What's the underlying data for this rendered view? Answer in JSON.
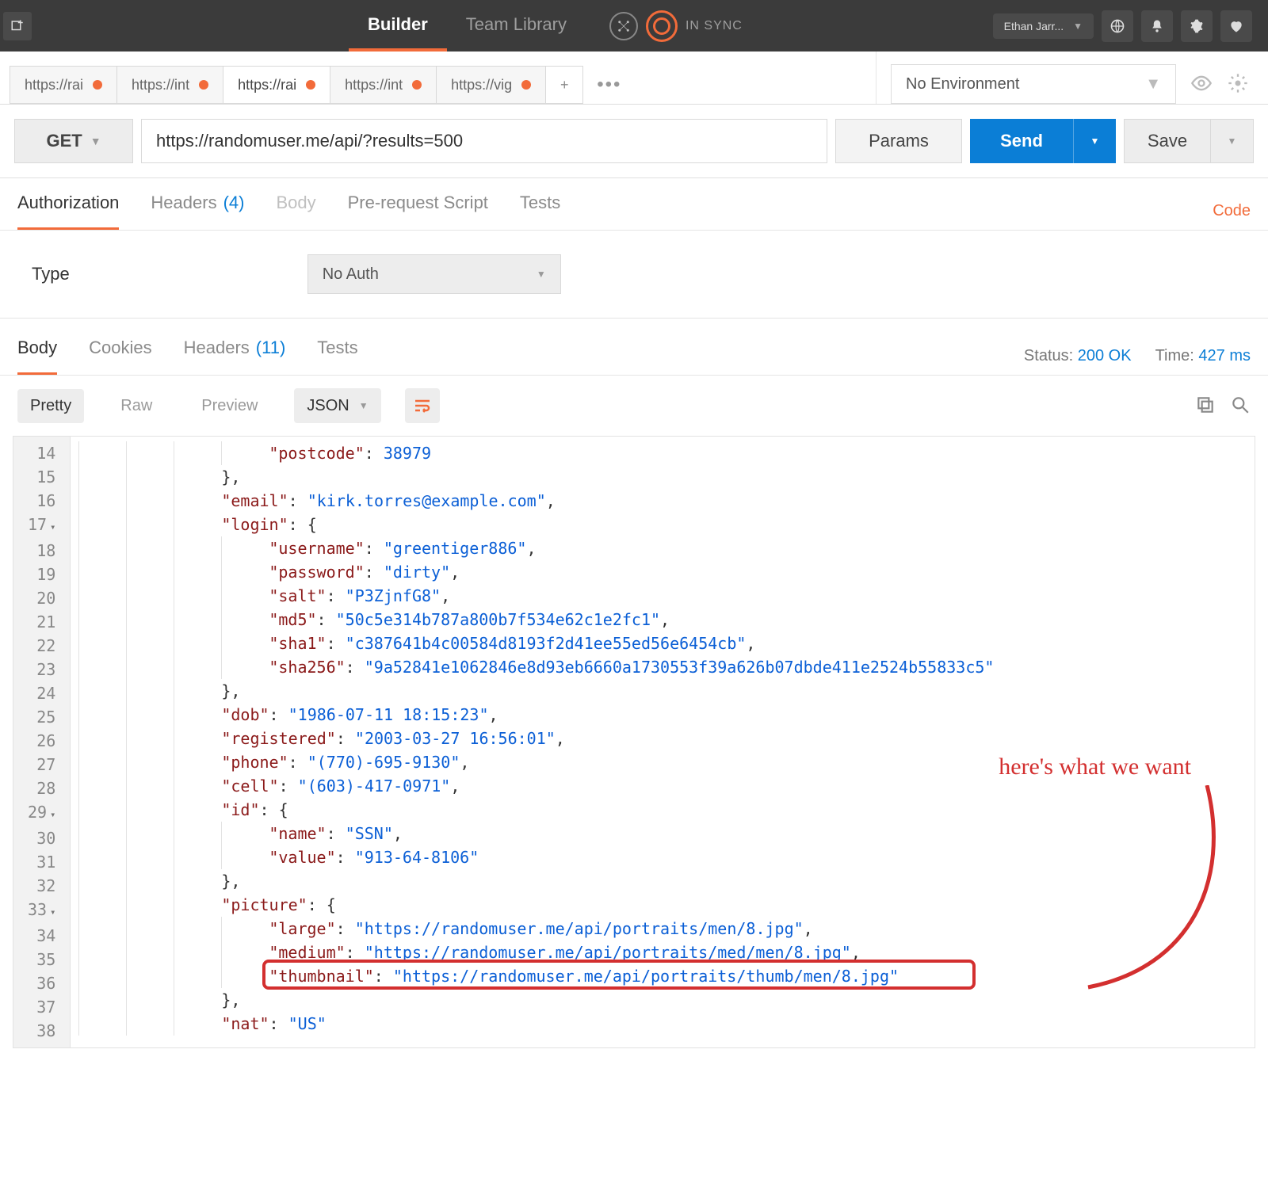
{
  "topbar": {
    "nav": {
      "builder": "Builder",
      "team": "Team Library"
    },
    "sync": "IN SYNC",
    "user": "Ethan Jarr..."
  },
  "tabs": [
    {
      "label": "https://rai",
      "active": false
    },
    {
      "label": "https://int",
      "active": false
    },
    {
      "label": "https://rai",
      "active": true
    },
    {
      "label": "https://int",
      "active": false
    },
    {
      "label": "https://vig",
      "active": false
    }
  ],
  "env": {
    "selected": "No Environment"
  },
  "request": {
    "method": "GET",
    "url": "https://randomuser.me/api/?results=500",
    "params": "Params",
    "send": "Send",
    "save": "Save"
  },
  "reqtabs": {
    "auth": "Authorization",
    "headers": "Headers",
    "headers_count": "(4)",
    "body": "Body",
    "prereq": "Pre-request Script",
    "tests": "Tests",
    "code": "Code"
  },
  "auth": {
    "label": "Type",
    "value": "No Auth"
  },
  "resptabs": {
    "body": "Body",
    "cookies": "Cookies",
    "headers": "Headers",
    "headers_count": "(11)",
    "tests": "Tests",
    "status_label": "Status:",
    "status_value": "200 OK",
    "time_label": "Time:",
    "time_value": "427 ms"
  },
  "viewbar": {
    "pretty": "Pretty",
    "raw": "Raw",
    "preview": "Preview",
    "format": "JSON"
  },
  "code_lines": [
    {
      "n": "14",
      "indent": 3,
      "key": "\"postcode\"",
      "sep": ": ",
      "val": "38979",
      "valclass": "num",
      "tail": ""
    },
    {
      "n": "15",
      "indent": 2,
      "raw": "},",
      "punctonly": true
    },
    {
      "n": "16",
      "indent": 2,
      "key": "\"email\"",
      "sep": ": ",
      "val": "\"kirk.torres@example.com\"",
      "valclass": "str",
      "tail": ","
    },
    {
      "n": "17",
      "fold": true,
      "indent": 2,
      "key": "\"login\"",
      "sep": ": ",
      "raw_after": "{",
      "tail": ""
    },
    {
      "n": "18",
      "indent": 3,
      "key": "\"username\"",
      "sep": ": ",
      "val": "\"greentiger886\"",
      "valclass": "str",
      "tail": ","
    },
    {
      "n": "19",
      "indent": 3,
      "key": "\"password\"",
      "sep": ": ",
      "val": "\"dirty\"",
      "valclass": "str",
      "tail": ","
    },
    {
      "n": "20",
      "indent": 3,
      "key": "\"salt\"",
      "sep": ": ",
      "val": "\"P3ZjnfG8\"",
      "valclass": "str",
      "tail": ","
    },
    {
      "n": "21",
      "indent": 3,
      "key": "\"md5\"",
      "sep": ": ",
      "val": "\"50c5e314b787a800b7f534e62c1e2fc1\"",
      "valclass": "str",
      "tail": ","
    },
    {
      "n": "22",
      "indent": 3,
      "key": "\"sha1\"",
      "sep": ": ",
      "val": "\"c387641b4c00584d8193f2d41ee55ed56e6454cb\"",
      "valclass": "str",
      "tail": ","
    },
    {
      "n": "23",
      "indent": 3,
      "key": "\"sha256\"",
      "sep": ": ",
      "val": "\"9a52841e1062846e8d93eb6660a1730553f39a626b07dbde411e2524b55833c5\"",
      "valclass": "str",
      "tail": ""
    },
    {
      "n": "24",
      "indent": 2,
      "raw": "},",
      "punctonly": true
    },
    {
      "n": "25",
      "indent": 2,
      "key": "\"dob\"",
      "sep": ": ",
      "val": "\"1986-07-11 18:15:23\"",
      "valclass": "str",
      "tail": ","
    },
    {
      "n": "26",
      "indent": 2,
      "key": "\"registered\"",
      "sep": ": ",
      "val": "\"2003-03-27 16:56:01\"",
      "valclass": "str",
      "tail": ","
    },
    {
      "n": "27",
      "indent": 2,
      "key": "\"phone\"",
      "sep": ": ",
      "val": "\"(770)-695-9130\"",
      "valclass": "str",
      "tail": ","
    },
    {
      "n": "28",
      "indent": 2,
      "key": "\"cell\"",
      "sep": ": ",
      "val": "\"(603)-417-0971\"",
      "valclass": "str",
      "tail": ","
    },
    {
      "n": "29",
      "fold": true,
      "indent": 2,
      "key": "\"id\"",
      "sep": ": ",
      "raw_after": "{",
      "tail": ""
    },
    {
      "n": "30",
      "indent": 3,
      "key": "\"name\"",
      "sep": ": ",
      "val": "\"SSN\"",
      "valclass": "str",
      "tail": ","
    },
    {
      "n": "31",
      "indent": 3,
      "key": "\"value\"",
      "sep": ": ",
      "val": "\"913-64-8106\"",
      "valclass": "str",
      "tail": ""
    },
    {
      "n": "32",
      "indent": 2,
      "raw": "},",
      "punctonly": true
    },
    {
      "n": "33",
      "fold": true,
      "indent": 2,
      "key": "\"picture\"",
      "sep": ": ",
      "raw_after": "{",
      "tail": ""
    },
    {
      "n": "34",
      "indent": 3,
      "key": "\"large\"",
      "sep": ": ",
      "val": "\"https://randomuser.me/api/portraits/men/8.jpg\"",
      "valclass": "str",
      "tail": ","
    },
    {
      "n": "35",
      "indent": 3,
      "key": "\"medium\"",
      "sep": ": ",
      "val": "\"https://randomuser.me/api/portraits/med/men/8.jpg\"",
      "valclass": "str",
      "tail": ","
    },
    {
      "n": "36",
      "indent": 3,
      "key": "\"thumbnail\"",
      "sep": ": ",
      "val": "\"https://randomuser.me/api/portraits/thumb/men/8.jpg\"",
      "valclass": "str",
      "tail": ""
    },
    {
      "n": "37",
      "indent": 2,
      "raw": "},",
      "punctonly": true
    },
    {
      "n": "38",
      "indent": 2,
      "key": "\"nat\"",
      "sep": ": ",
      "val": "\"US\"",
      "valclass": "str",
      "tail": ""
    }
  ],
  "annotation": {
    "text": "here's what we want"
  }
}
